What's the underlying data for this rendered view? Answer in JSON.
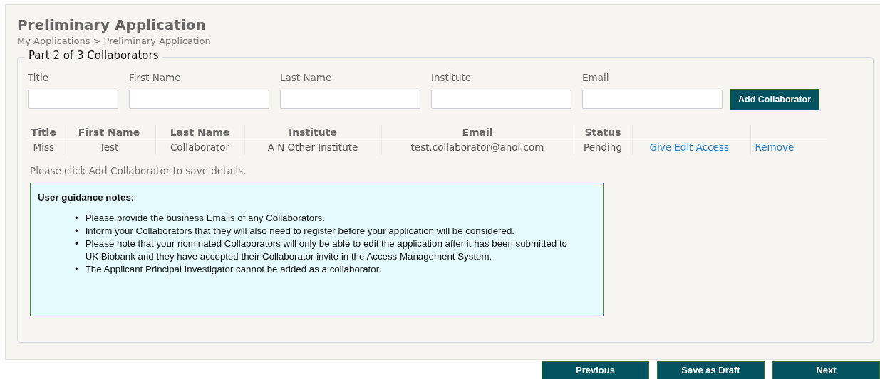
{
  "page": {
    "title": "Preliminary Application",
    "breadcrumb": "My Applications > Preliminary Application"
  },
  "section": {
    "legend": "Part 2 of 3 Collaborators",
    "fields": [
      {
        "label": "Title"
      },
      {
        "label": "First Name"
      },
      {
        "label": "Last Name"
      },
      {
        "label": "Institute"
      },
      {
        "label": "Email"
      }
    ],
    "add_button": "Add Collaborator",
    "table": {
      "columns": [
        "Title",
        "First Name",
        "Last Name",
        "Institute",
        "Email",
        "Status"
      ],
      "rows": [
        {
          "cells": [
            "Miss",
            "Test",
            "Collaborator",
            "A N Other Institute",
            "test.collaborator@anoi.com",
            "Pending"
          ],
          "actions": [
            "Give Edit Access",
            "Remove"
          ]
        }
      ]
    },
    "hint": "Please click Add Collaborator to save details.",
    "guidance": {
      "title": "User guidance notes:",
      "bullet": "•",
      "items": [
        "Please provide the business Emails of any Collaborators.",
        "Inform your Collaborators that they will also need to register before your application will be considered.",
        "Please note that your nominated Collaborators will only be able to edit the application after it has been submitted to UK Biobank and they have accepted their Collaborator invite in the Access Management System.",
        "The Applicant Principal Investigator cannot be added as a collaborator."
      ]
    }
  },
  "buttons": [
    "Previous",
    "Save as Draft",
    "Next"
  ]
}
